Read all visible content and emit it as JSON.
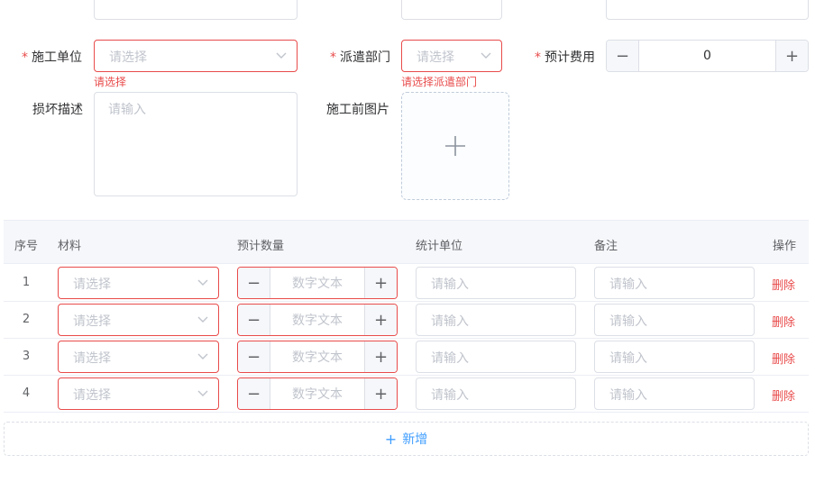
{
  "form": {
    "construction_unit": {
      "label": "施工单位",
      "placeholder": "请选择",
      "error": "请选择"
    },
    "dispatch_dept": {
      "label": "派遣部门",
      "placeholder": "请选择",
      "error": "请选择派遣部门"
    },
    "estimated_cost": {
      "label": "预计费用",
      "value": "0",
      "minus": "−",
      "plus": "+"
    },
    "damage_desc": {
      "label": "损坏描述",
      "placeholder": "请输入"
    },
    "pre_images": {
      "label": "施工前图片"
    }
  },
  "table": {
    "headers": {
      "index": "序号",
      "material": "材料",
      "qty": "预计数量",
      "unit": "统计单位",
      "remark": "备注",
      "action": "操作"
    },
    "rows": [
      {
        "index": "1",
        "material_ph": "请选择",
        "qty_ph": "数字文本",
        "unit_ph": "请输入",
        "remark_ph": "请输入",
        "delete": "删除"
      },
      {
        "index": "2",
        "material_ph": "请选择",
        "qty_ph": "数字文本",
        "unit_ph": "请输入",
        "remark_ph": "请输入",
        "delete": "删除"
      },
      {
        "index": "3",
        "material_ph": "请选择",
        "qty_ph": "数字文本",
        "unit_ph": "请输入",
        "remark_ph": "请输入",
        "delete": "删除"
      },
      {
        "index": "4",
        "material_ph": "请选择",
        "qty_ph": "数字文本",
        "unit_ph": "请输入",
        "remark_ph": "请输入",
        "delete": "删除"
      }
    ],
    "stepper_minus": "−",
    "stepper_plus": "+",
    "add_label": "新增",
    "add_plus": "+"
  },
  "colors": {
    "error": "#e94b4b",
    "primary": "#409eff",
    "border": "#dcdfe6"
  }
}
